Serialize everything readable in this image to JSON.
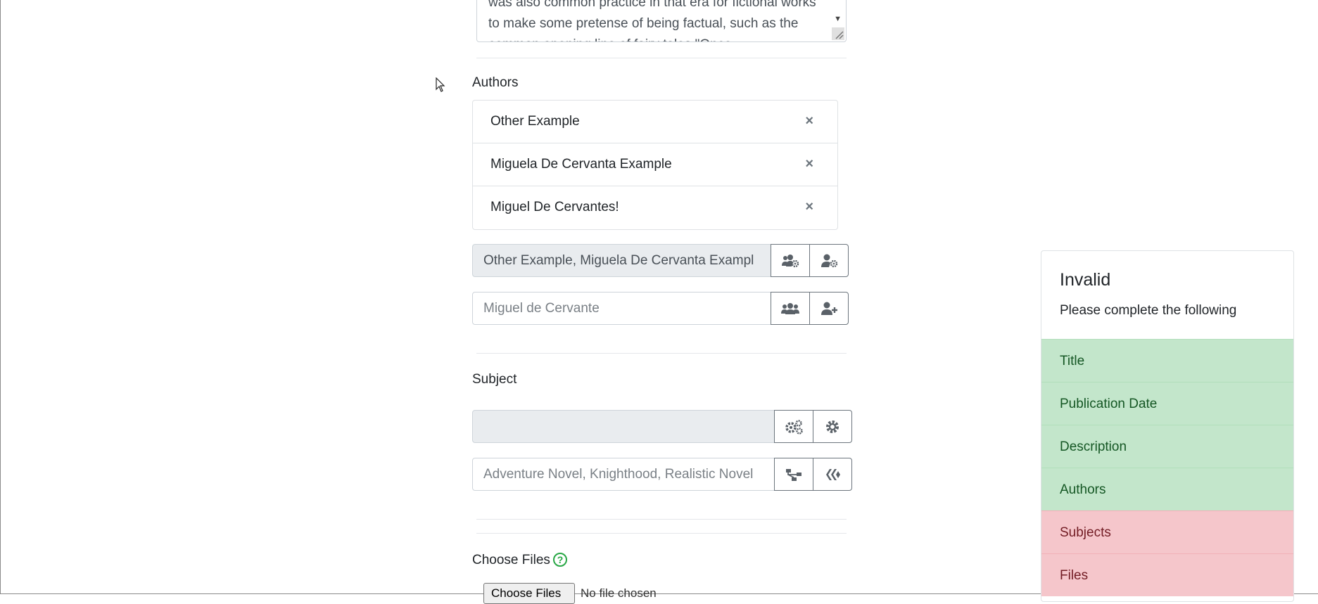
{
  "description": {
    "text": "was also common practice in that era for fictional works to make some pretense of being factual, such as the common opening line of fairy tales \"Once"
  },
  "authors": {
    "label": "Authors",
    "list": [
      "Other Example",
      "Miguela De Cervanta Example",
      "Miguel De Cervantes!"
    ],
    "remove_symbol": "×",
    "selected_value": "Other Example, Miguela De Cervanta Exampl",
    "search_placeholder": "Miguel de Cervante",
    "buttons": {
      "manage_group_icon": "users-cog-icon",
      "manage_user_icon": "user-cog-icon",
      "search_group_icon": "users-icon",
      "add_user_icon": "user-plus-icon"
    }
  },
  "subject": {
    "label": "Subject",
    "selected_value": "",
    "search_placeholder": "Adventure Novel, Knighthood, Realistic Novel",
    "buttons": {
      "manage_icon": "cogs-icon",
      "settings_icon": "cog-icon",
      "tree_icon": "sitemap-icon",
      "api_icon": "hive-icon"
    }
  },
  "files": {
    "label": "Choose Files",
    "help_symbol": "?",
    "choose_button": "Choose Files",
    "status": "No file chosen"
  },
  "validation": {
    "title": "Invalid",
    "subtitle": "Please complete the following",
    "items": [
      {
        "label": "Title",
        "status": "ok"
      },
      {
        "label": "Publication Date",
        "status": "ok"
      },
      {
        "label": "Description",
        "status": "ok"
      },
      {
        "label": "Authors",
        "status": "ok"
      },
      {
        "label": "Subjects",
        "status": "bad"
      },
      {
        "label": "Files",
        "status": "bad"
      }
    ],
    "colors": {
      "ok_bg": "#c3e6cb",
      "ok_text": "#155724",
      "bad_bg": "#f5c6cb",
      "bad_text": "#721c24"
    }
  }
}
